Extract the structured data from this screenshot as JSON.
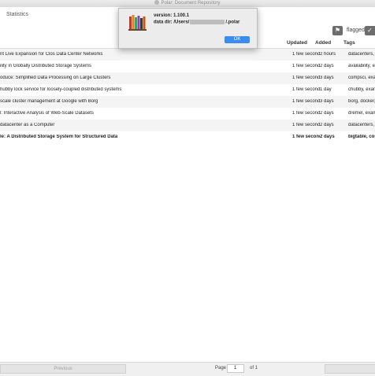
{
  "window": {
    "title": "Polar: Document Repository"
  },
  "header": {
    "tab_label": "Statistics"
  },
  "toolbar": {
    "flagged_label": "flagged",
    "flag_icon": "flag-icon",
    "check_icon": "checkmark-icon"
  },
  "columns": {
    "updated": "Updated",
    "added": "Added",
    "tags": "Tags"
  },
  "rows": [
    {
      "title": "nt Live Expansion for Clos Data Center Networks",
      "updated": "1 few seconds",
      "added": "2 hours",
      "tags": "datacenters, e",
      "bold": false
    },
    {
      "title": "ility in Globally Distributed Storage Systems",
      "updated": "1 few seconds",
      "added": "2 days",
      "tags": "availability, ex",
      "bold": false
    },
    {
      "title": "oduce: Simplified Data Processing on Large Clusters",
      "updated": "1 few seconds",
      "added": "3 days",
      "tags": "compsci, exar",
      "bold": false
    },
    {
      "title": "hubby lock service for loosely-coupled distributed systems",
      "updated": "1 few seconds",
      "added": "1 day",
      "tags": "chubby, exam",
      "bold": false
    },
    {
      "title": "scale cluster management at Google with Borg",
      "updated": "1 few seconds",
      "added": "3 days",
      "tags": "borg, docker, g",
      "bold": false
    },
    {
      "title": "l: Interactive Analysis of Web-Scale Datasets",
      "updated": "1 few seconds",
      "added": "2 days",
      "tags": "dremel, exam",
      "bold": false
    },
    {
      "title": "datacenter as a Computer",
      "updated": "1 few seconds",
      "added": "2 days",
      "tags": "datacenters, e",
      "bold": false
    },
    {
      "title": "le: A Distributed Storage System for Structured Data",
      "updated": "1 few seconds",
      "added": "2 days",
      "tags": "bigtable, com",
      "bold": true
    }
  ],
  "pagination": {
    "previous_label": "Previous",
    "page_label": "Page",
    "page_value": "1",
    "of_label": "of 1"
  },
  "dialog": {
    "version": "version:  1.100.1",
    "datadir_prefix": "data dir: /Users/",
    "datadir_suffix": "/.polar",
    "ok_label": "OK",
    "icon": "books-icon"
  }
}
